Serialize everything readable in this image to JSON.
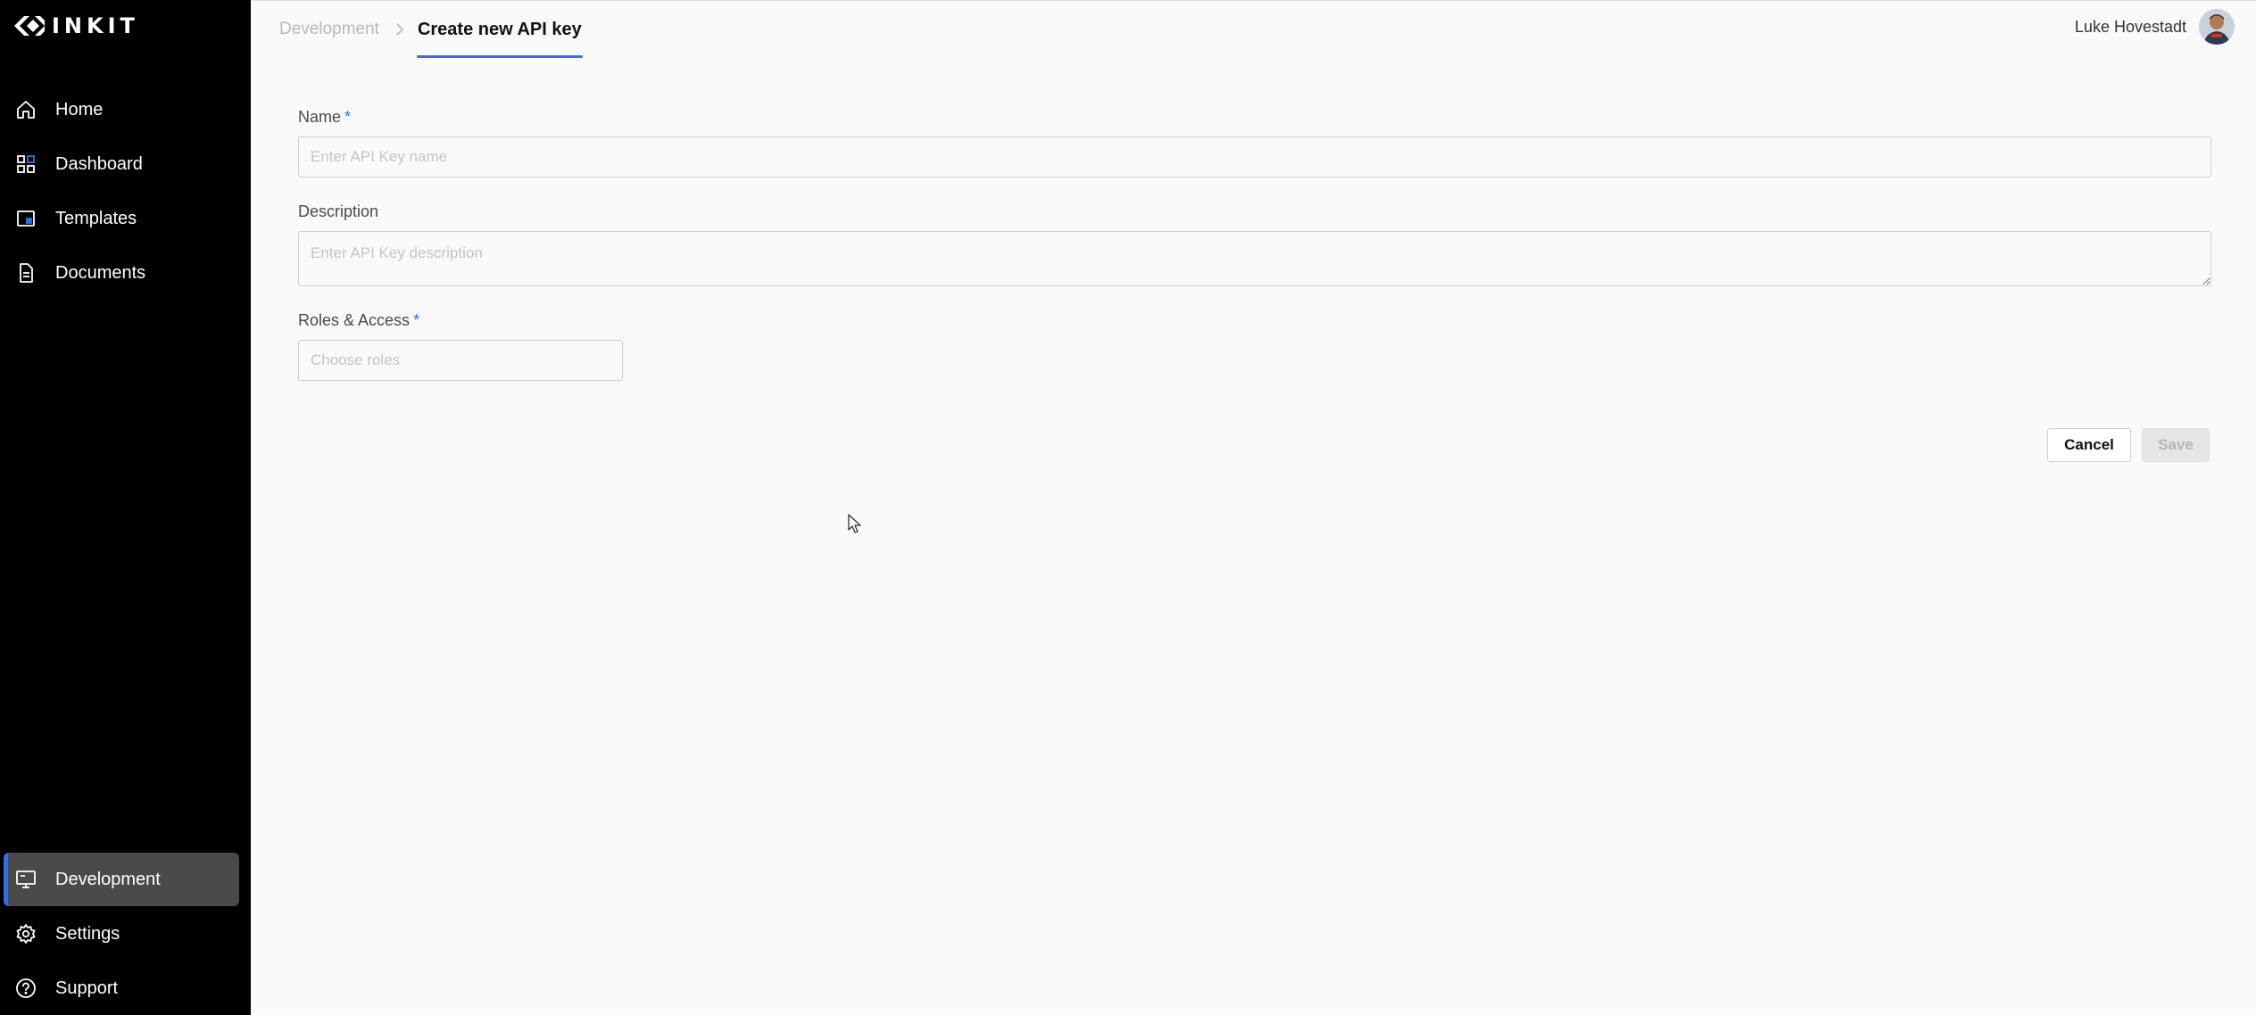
{
  "brand": {
    "name": "INKIT"
  },
  "sidebar": {
    "top_items": [
      {
        "label": "Home",
        "icon": "home-icon"
      },
      {
        "label": "Dashboard",
        "icon": "dashboard-icon"
      },
      {
        "label": "Templates",
        "icon": "templates-icon"
      },
      {
        "label": "Documents",
        "icon": "document-icon"
      }
    ],
    "bottom_items": [
      {
        "label": "Development",
        "icon": "monitor-icon",
        "active": true
      },
      {
        "label": "Settings",
        "icon": "gear-icon"
      },
      {
        "label": "Support",
        "icon": "help-circle-icon"
      }
    ]
  },
  "breadcrumb": {
    "parent": "Development",
    "current": "Create new API key"
  },
  "user": {
    "name": "Luke Hovestadt"
  },
  "form": {
    "name": {
      "label": "Name",
      "required_mark": "*",
      "placeholder": "Enter API Key name",
      "value": ""
    },
    "description": {
      "label": "Description",
      "placeholder": "Enter API Key description",
      "value": ""
    },
    "roles": {
      "label": "Roles & Access",
      "required_mark": "*",
      "placeholder": "Choose roles"
    }
  },
  "actions": {
    "cancel": "Cancel",
    "save": "Save"
  },
  "colors": {
    "sidebar_bg": "#000000",
    "active_nav_bg": "#4a4a4a",
    "accent": "#2f6fed",
    "page_bg": "#fafafa"
  }
}
